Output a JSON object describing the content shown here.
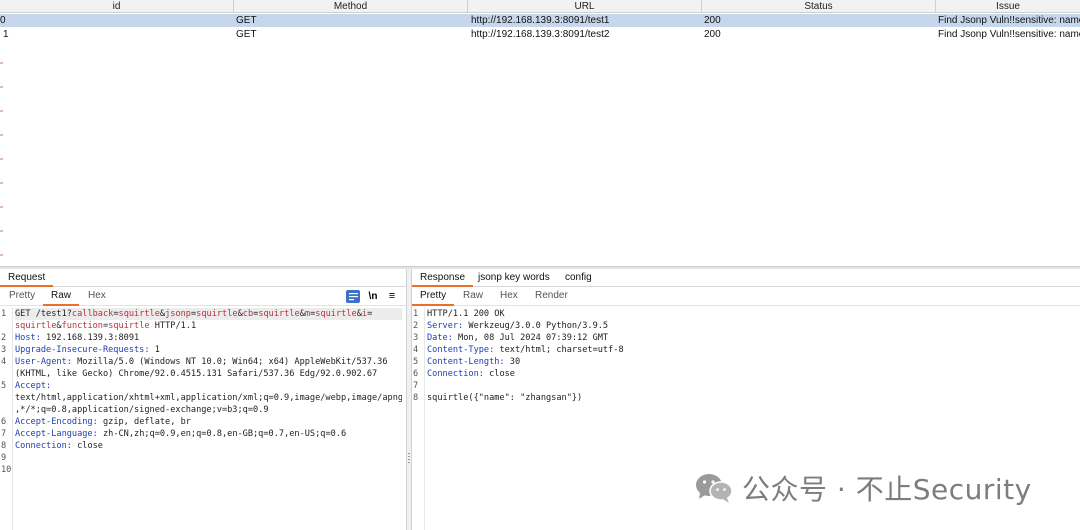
{
  "table": {
    "columns": [
      "id",
      "Method",
      "URL",
      "Status",
      "Issue"
    ],
    "rows": [
      {
        "id": "0",
        "method": "GET",
        "url": "http://192.168.139.3:8091/test1",
        "status": "200",
        "issue": "Find Jsonp Vuln!!sensitive: name"
      },
      {
        "id": "1",
        "method": "GET",
        "url": "http://192.168.139.3:8091/test2",
        "status": "200",
        "issue": "Find Jsonp Vuln!!sensitive: name"
      }
    ],
    "selected_row": 0
  },
  "request": {
    "tab": "Request",
    "subtabs": [
      "Pretty",
      "Raw",
      "Hex"
    ],
    "active_subtab": "Raw",
    "toolbar": {
      "wrap_icon": "wrap-lines-icon",
      "newline_label": "\\n",
      "menu_label": "≡"
    },
    "line_numbers": [
      "1",
      "2",
      "3",
      "4",
      "5",
      "6",
      "7",
      "8",
      "9",
      "10"
    ],
    "lines": {
      "l1_a": "GET /test1?",
      "l1_p1k": "callback",
      "l1_p1v": "squirtle",
      "l1_p2k": "jsonp",
      "l1_p2v": "squirtle",
      "l1_p3k": "cb",
      "l1_p3v": "squirtle",
      "l1_p4k": "m",
      "l1_p4v": "squirtle",
      "l1_p5k": "i",
      "l1b_v": "squirtle",
      "l1b_p6k": "function",
      "l1b_p6v": "squirtle",
      "l1b_tail": " HTTP/1.1",
      "l2_k": "Host:",
      "l2_v": " 192.168.139.3:8091",
      "l3_k": "Upgrade-Insecure-Requests:",
      "l3_v": " 1",
      "l4_k": "User-Agent:",
      "l4_v": " Mozilla/5.0 (Windows NT 10.0; Win64; x64) AppleWebKit/537.36",
      "l4b": "(KHTML, like Gecko) Chrome/92.0.4515.131 Safari/537.36 Edg/92.0.902.67",
      "l5_k": "Accept:",
      "l5b": "text/html,application/xhtml+xml,application/xml;q=0.9,image/webp,image/apng",
      "l5c": ",*/*;q=0.8,application/signed-exchange;v=b3;q=0.9",
      "l6_k": "Accept-Encoding:",
      "l6_v": " gzip, deflate, br",
      "l7_k": "Accept-Language:",
      "l7_v": " zh-CN,zh;q=0.9,en;q=0.8,en-GB;q=0.7,en-US;q=0.6",
      "l8_k": "Connection:",
      "l8_v": " close"
    }
  },
  "response": {
    "tabs": [
      "Response",
      "jsonp key words",
      "config"
    ],
    "active_tab": "Response",
    "subtabs": [
      "Pretty",
      "Raw",
      "Hex",
      "Render"
    ],
    "active_subtab": "Pretty",
    "line_numbers": [
      "1",
      "2",
      "3",
      "4",
      "5",
      "6",
      "7",
      "8"
    ],
    "lines": {
      "l1": "HTTP/1.1 200 OK",
      "l2_k": "Server:",
      "l2_v": " Werkzeug/3.0.0 Python/3.9.5",
      "l3_k": "Date:",
      "l3_v": " Mon, 08 Jul 2024 07:39:12 GMT",
      "l4_k": "Content-Type:",
      "l4_v": " text/html; charset=utf-8",
      "l5_k": "Content-Length:",
      "l5_v": " 30",
      "l6_k": "Connection:",
      "l6_v": " close",
      "l8": "squirtle({\"name\": \"zhangsan\"})"
    }
  },
  "watermark": {
    "text": "公众号 · 不止Security",
    "logo_icon": "wechat-logo-icon"
  },
  "colors": {
    "accent": "#e8702a",
    "selection": "#c6d6ec",
    "key": "#1e3fb0",
    "param": "#b8323c"
  }
}
